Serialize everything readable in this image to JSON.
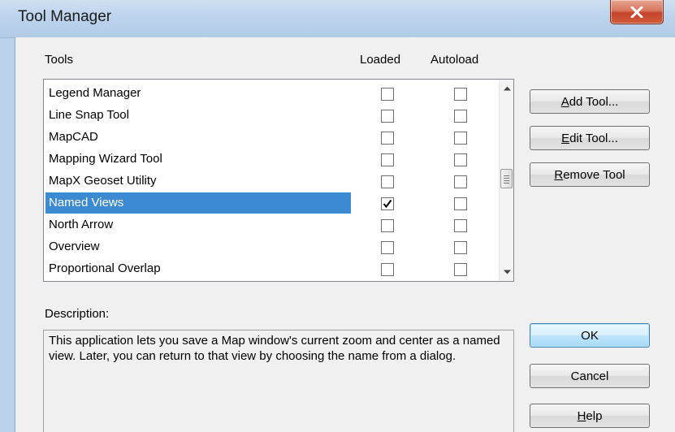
{
  "window": {
    "title": "Tool Manager"
  },
  "headers": {
    "tools": "Tools",
    "loaded": "Loaded",
    "autoload": "Autoload"
  },
  "tools": [
    {
      "name": "Legend Manager",
      "loaded": false,
      "autoload": false,
      "selected": false
    },
    {
      "name": "Line Snap Tool",
      "loaded": false,
      "autoload": false,
      "selected": false
    },
    {
      "name": "MapCAD",
      "loaded": false,
      "autoload": false,
      "selected": false
    },
    {
      "name": "Mapping Wizard Tool",
      "loaded": false,
      "autoload": false,
      "selected": false
    },
    {
      "name": "MapX Geoset Utility",
      "loaded": false,
      "autoload": false,
      "selected": false
    },
    {
      "name": "Named Views",
      "loaded": true,
      "autoload": false,
      "selected": true
    },
    {
      "name": "North Arrow",
      "loaded": false,
      "autoload": false,
      "selected": false
    },
    {
      "name": "Overview",
      "loaded": false,
      "autoload": false,
      "selected": false
    },
    {
      "name": "Proportional Overlap",
      "loaded": false,
      "autoload": false,
      "selected": false
    }
  ],
  "buttons": {
    "add_tool": {
      "underline": "A",
      "rest": "dd Tool..."
    },
    "edit_tool": {
      "underline": "E",
      "rest": "dit Tool..."
    },
    "remove_tool": {
      "underline": "R",
      "rest": "emove Tool"
    },
    "ok": "OK",
    "cancel": "Cancel",
    "help": {
      "underline": "H",
      "rest": "elp"
    }
  },
  "description": {
    "label": "Description:",
    "text": "This application lets you save a Map window's current zoom and center as a named view.  Later, you can return to that view by choosing the name from a dialog."
  },
  "icons": {
    "close": "close-icon",
    "scroll_up": "scroll-up-arrow-icon",
    "scroll_down": "scroll-down-arrow-icon",
    "check": "check-icon"
  },
  "colors": {
    "selection": "#3c8ad1",
    "close_button": "#c4432a",
    "titlebar": "#bcd3ec"
  }
}
